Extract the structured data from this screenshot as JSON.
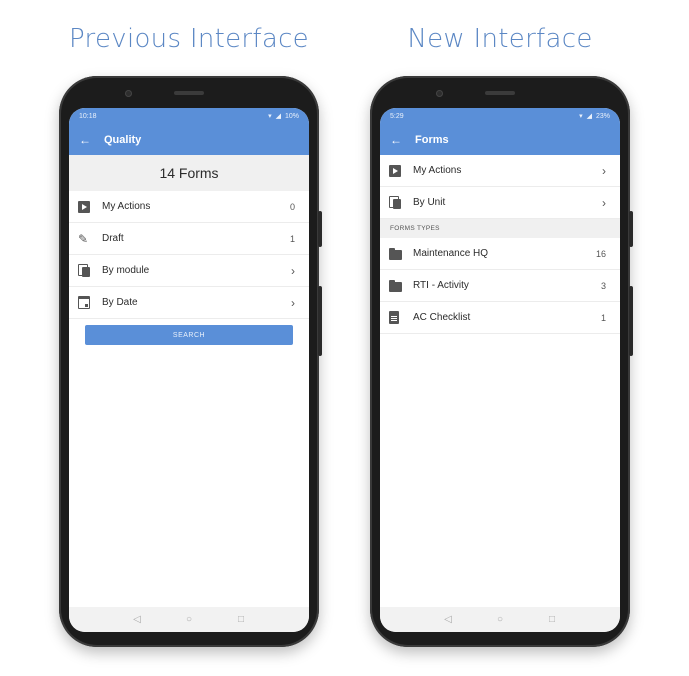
{
  "captions": {
    "previous": "Previous Interface",
    "new": "New Interface"
  },
  "previous": {
    "status_time": "10:18",
    "status_battery": "10%",
    "title": "Quality",
    "count_header": "14 Forms",
    "rows": [
      {
        "label": "My Actions",
        "count": "0",
        "icon": "play-square-icon"
      },
      {
        "label": "Draft",
        "count": "1",
        "icon": "pencil-icon"
      },
      {
        "label": "By module",
        "icon": "copy-icon"
      },
      {
        "label": "By Date",
        "icon": "calendar-icon"
      }
    ],
    "search_label": "SEARCH"
  },
  "new": {
    "status_time": "5:29",
    "status_battery": "23%",
    "title": "Forms",
    "rows": [
      {
        "label": "My Actions",
        "icon": "play-square-icon"
      },
      {
        "label": "By Unit",
        "icon": "copy-icon"
      }
    ],
    "section_header": "FORMS TYPES",
    "form_types": [
      {
        "label": "Maintenance HQ",
        "count": "16",
        "icon": "folder-icon"
      },
      {
        "label": "RTI - Activity",
        "count": "3",
        "icon": "folder-icon"
      },
      {
        "label": "AC Checklist",
        "count": "1",
        "icon": "document-icon"
      }
    ]
  },
  "glyphs": {
    "back": "←",
    "chevron": "›",
    "nav_back": "◁",
    "nav_home": "○",
    "nav_recent": "□"
  },
  "colors": {
    "accent": "#5a8fd8",
    "caption": "#5b87c4"
  }
}
